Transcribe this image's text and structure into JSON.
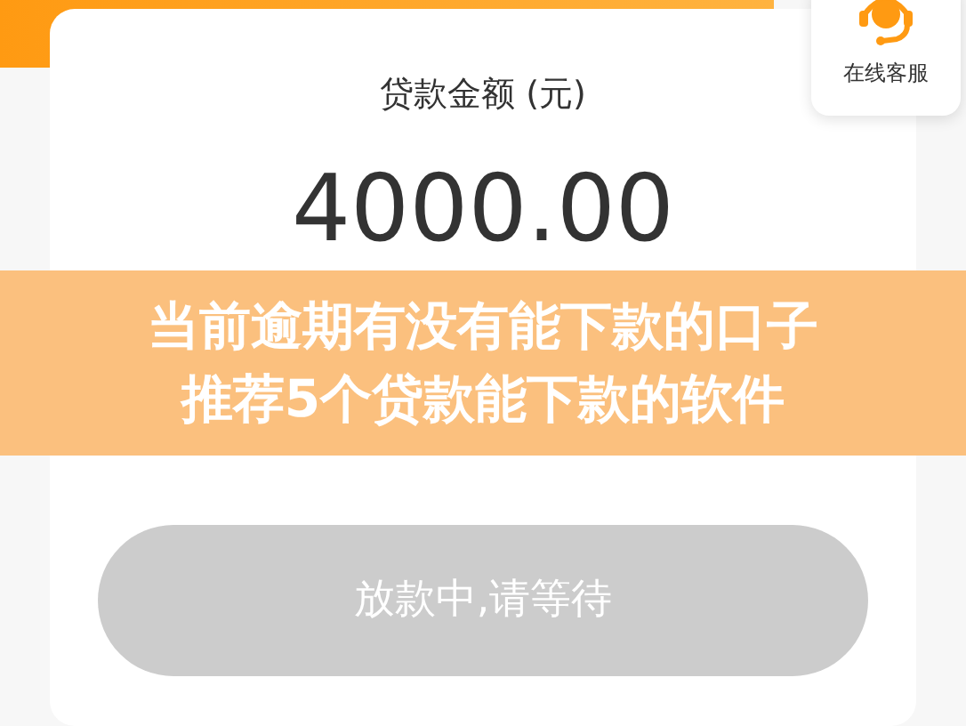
{
  "customer_service": {
    "label": "在线客服"
  },
  "loan": {
    "label": "贷款金额 (元)",
    "amount": "4000.00"
  },
  "action_button": {
    "label": "放款中,请等待",
    "disabled": true
  },
  "banner": {
    "lines": [
      "当前逾期有没有能下款的口子",
      "推荐5个贷款能下款的软件"
    ]
  }
}
